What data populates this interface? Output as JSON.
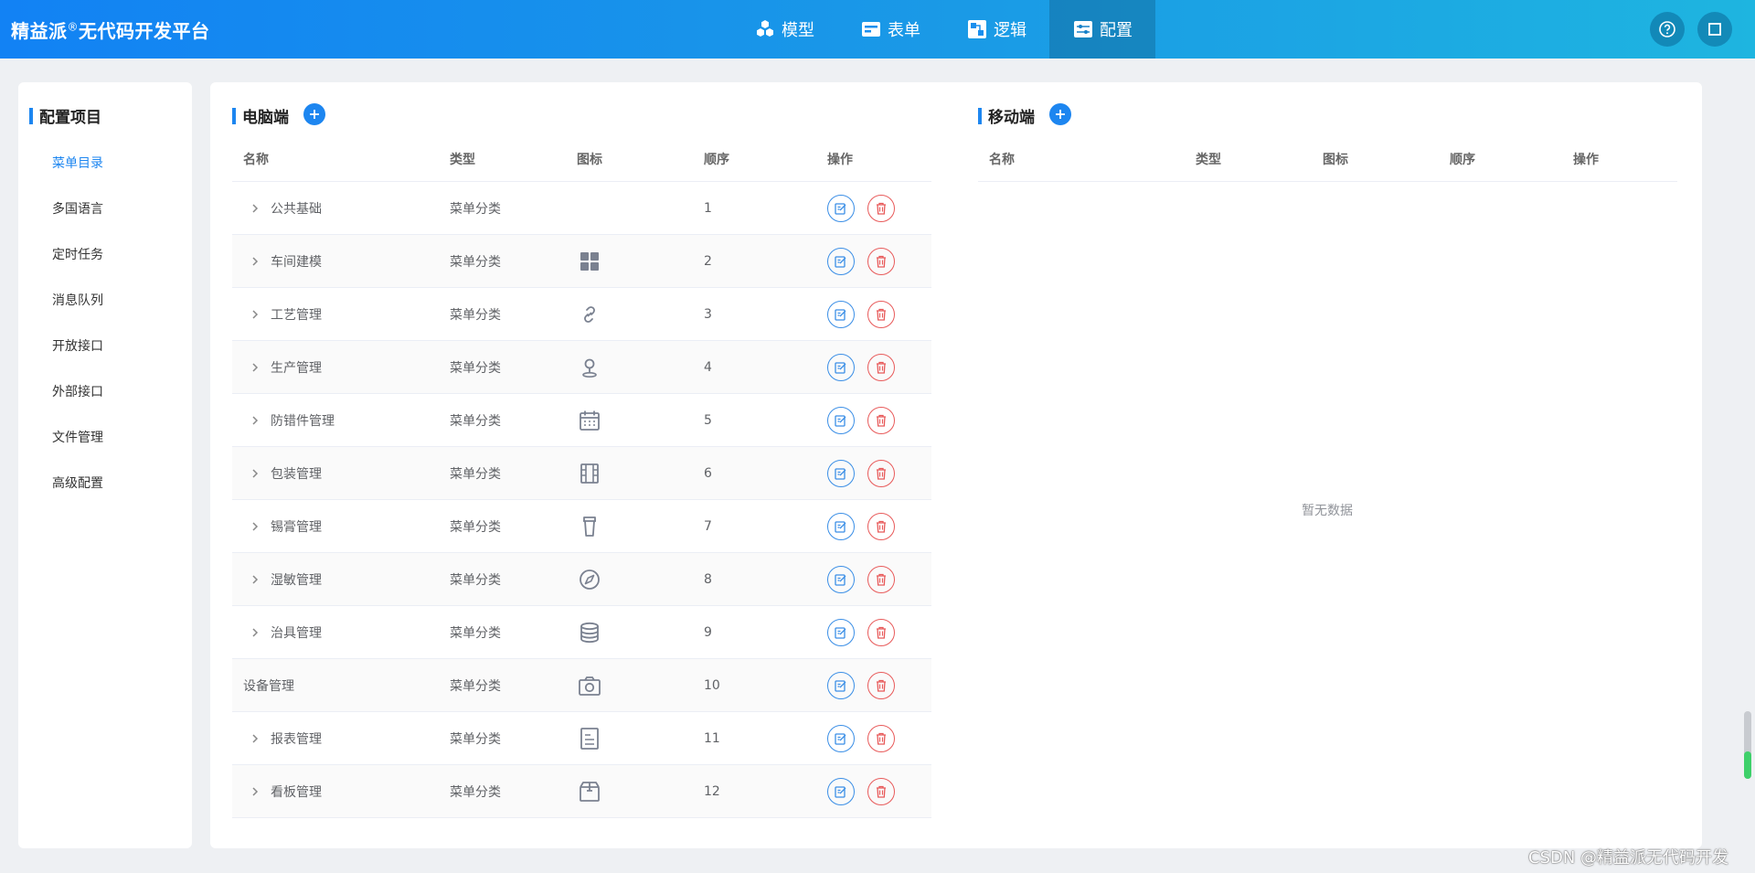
{
  "header": {
    "brand_main": "精益派",
    "brand_sup": "®",
    "brand_rest": "无代码开发平台",
    "nav": [
      {
        "label": "模型",
        "icon": "cubes-icon"
      },
      {
        "label": "表单",
        "icon": "form-icon"
      },
      {
        "label": "逻辑",
        "icon": "logic-icon"
      },
      {
        "label": "配置",
        "icon": "config-icon",
        "active": true
      }
    ],
    "help_icon": "help-icon",
    "fullscreen_icon": "fullscreen-icon"
  },
  "left_panel": {
    "title": "配置项目",
    "items": [
      {
        "label": "菜单目录",
        "active": true
      },
      {
        "label": "多国语言"
      },
      {
        "label": "定时任务"
      },
      {
        "label": "消息队列"
      },
      {
        "label": "开放接口"
      },
      {
        "label": "外部接口"
      },
      {
        "label": "文件管理"
      },
      {
        "label": "高级配置"
      }
    ]
  },
  "pc": {
    "title": "电脑端",
    "columns": [
      "名称",
      "类型",
      "图标",
      "顺序",
      "操作"
    ],
    "rows": [
      {
        "name": "公共基础",
        "type": "菜单分类",
        "icon": "",
        "order": "1",
        "expand": true
      },
      {
        "name": "车间建模",
        "type": "菜单分类",
        "icon": "grid-icon",
        "order": "2",
        "expand": true
      },
      {
        "name": "工艺管理",
        "type": "菜单分类",
        "icon": "link-icon",
        "order": "3",
        "expand": true
      },
      {
        "name": "生产管理",
        "type": "菜单分类",
        "icon": "location-icon",
        "order": "4",
        "expand": true
      },
      {
        "name": "防错件管理",
        "type": "菜单分类",
        "icon": "calendar-icon",
        "order": "5",
        "expand": true
      },
      {
        "name": "包装管理",
        "type": "菜单分类",
        "icon": "film-icon",
        "order": "6",
        "expand": true
      },
      {
        "name": "锡膏管理",
        "type": "菜单分类",
        "icon": "cup-icon",
        "order": "7",
        "expand": true
      },
      {
        "name": "湿敏管理",
        "type": "菜单分类",
        "icon": "compass-icon",
        "order": "8",
        "expand": true
      },
      {
        "name": "治具管理",
        "type": "菜单分类",
        "icon": "database-icon",
        "order": "9",
        "expand": true
      },
      {
        "name": "设备管理",
        "type": "菜单分类",
        "icon": "camera-icon",
        "order": "10",
        "expand": false
      },
      {
        "name": "报表管理",
        "type": "菜单分类",
        "icon": "document-icon",
        "order": "11",
        "expand": true
      },
      {
        "name": "看板管理",
        "type": "菜单分类",
        "icon": "box-icon",
        "order": "12",
        "expand": true
      }
    ]
  },
  "mobile": {
    "title": "移动端",
    "columns": [
      "名称",
      "类型",
      "图标",
      "顺序",
      "操作"
    ],
    "empty_text": "暂无数据"
  },
  "watermark": "CSDN @精益派无代码开发",
  "colors": {
    "primary": "#1d86f0",
    "danger": "#e85a5a",
    "header_start": "#1282f4",
    "header_end": "#1eb5e0"
  }
}
